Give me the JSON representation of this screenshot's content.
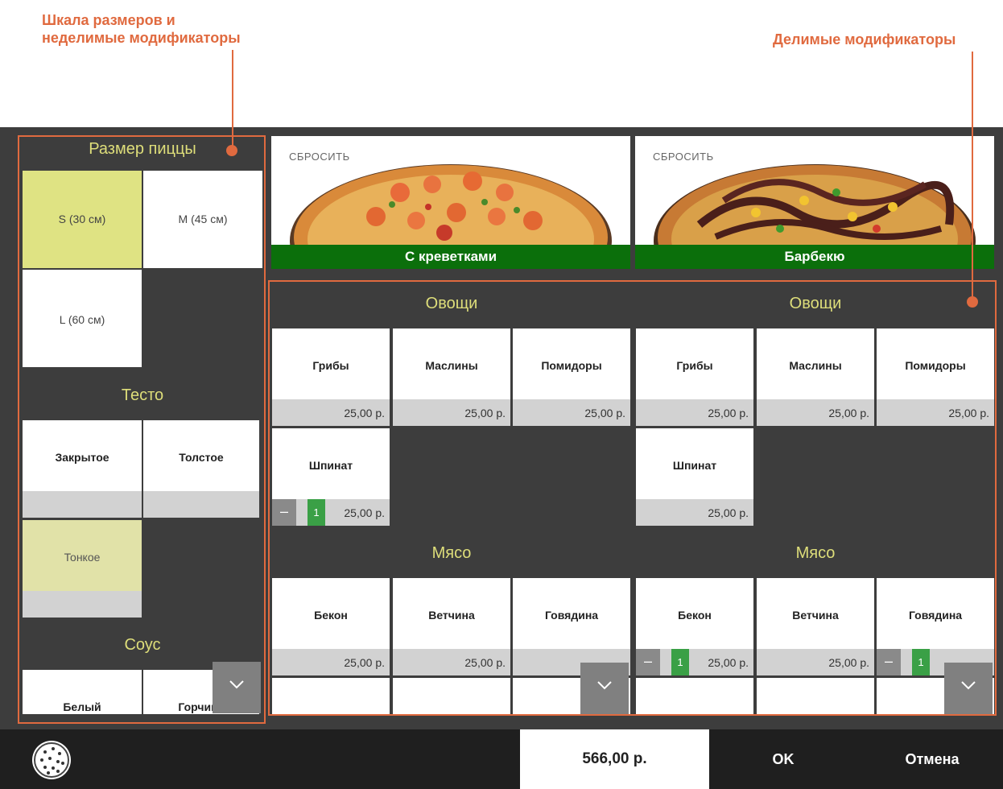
{
  "annotations": {
    "left": "Шкала размеров и\nнеделимые модификаторы",
    "right": "Делимые модификаторы"
  },
  "sizes": {
    "title": "Размер пиццы",
    "items": [
      "S (30 см)",
      "M (45 см)",
      "L (60 см)"
    ],
    "selected": "S (30 см)"
  },
  "dough": {
    "title": "Тесто",
    "items": [
      "Закрытое",
      "Толстое",
      "Тонкое"
    ],
    "selected": "Тонкое"
  },
  "sauce": {
    "title": "Соус",
    "items": [
      "Белый",
      "Горчица"
    ]
  },
  "pizzas": [
    {
      "reset_label": "СБРОСИТЬ",
      "name": "С креветками"
    },
    {
      "reset_label": "СБРОСИТЬ",
      "name": "Барбекю"
    }
  ],
  "halves": [
    {
      "vegetables_title": "Овощи",
      "vegetables": [
        {
          "name": "Грибы",
          "price": "25,00 р."
        },
        {
          "name": "Маслины",
          "price": "25,00 р."
        },
        {
          "name": "Помидоры",
          "price": "25,00 р."
        },
        {
          "name": "Шпинат",
          "price": "25,00 р.",
          "qty": "1"
        }
      ],
      "meat_title": "Мясо",
      "meat": [
        {
          "name": "Бекон",
          "price": "25,00 р."
        },
        {
          "name": "Ветчина",
          "price": "25,00 р."
        },
        {
          "name": "Говядина",
          "price": ""
        }
      ]
    },
    {
      "vegetables_title": "Овощи",
      "vegetables": [
        {
          "name": "Грибы",
          "price": "25,00 р."
        },
        {
          "name": "Маслины",
          "price": "25,00 р."
        },
        {
          "name": "Помидоры",
          "price": "25,00 р."
        },
        {
          "name": "Шпинат",
          "price": "25,00 р."
        }
      ],
      "meat_title": "Мясо",
      "meat": [
        {
          "name": "Бекон",
          "price": "25,00 р.",
          "qty": "1"
        },
        {
          "name": "Ветчина",
          "price": "25,00 р."
        },
        {
          "name": "Говядина",
          "price": "",
          "qty": "1"
        }
      ]
    }
  ],
  "footer": {
    "total": "566,00 р.",
    "ok_label": "OK",
    "cancel_label": "Отмена"
  },
  "icons": {
    "pizza": "pizza-icon",
    "scroll": "chevron-down-icon",
    "minus": "minus-icon"
  },
  "colors": {
    "accent": "#e06a3f",
    "section_title": "#dede7a",
    "selected_tile": "#dfe383",
    "pizza_name_bar": "#0b6f0b",
    "qty_badge": "#3aa046"
  }
}
